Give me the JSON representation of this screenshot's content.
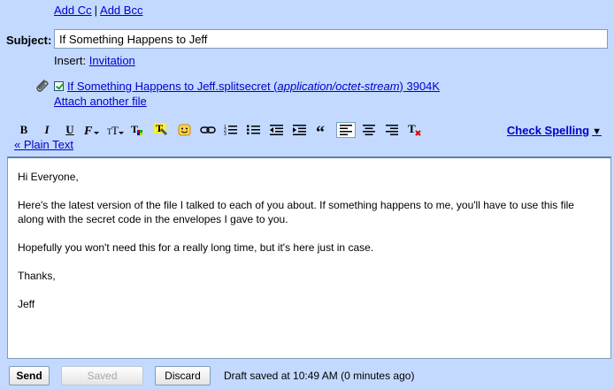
{
  "header": {
    "add_cc": "Add Cc",
    "cc_separator": "|",
    "add_bcc": "Add Bcc"
  },
  "subject": {
    "label": "Subject:",
    "value": "If Something Happens to Jeff"
  },
  "insert": {
    "label": "Insert:",
    "invitation": "Invitation"
  },
  "attachment": {
    "checked": true,
    "file_name": "If Something Happens to Jeff.splitsecret",
    "mime_type": "application/octet-stream",
    "size": "3904K",
    "attach_another": "Attach another file"
  },
  "toolbar": {
    "icons": [
      "bold-icon",
      "italic-icon",
      "underline-icon",
      "font-icon",
      "font-size-icon",
      "text-color-icon",
      "highlight-icon",
      "emoticon-icon",
      "link-icon",
      "numbered-list-icon",
      "bulleted-list-icon",
      "indent-less-icon",
      "indent-more-icon",
      "quote-icon",
      "align-left-icon",
      "align-center-icon",
      "align-right-icon",
      "remove-formatting-icon"
    ],
    "active": "align-left-icon",
    "check_spelling": "Check Spelling",
    "plain_text": "« Plain Text"
  },
  "body": {
    "paragraphs": [
      "Hi Everyone,",
      "Here's the latest version of the file I talked to each of you about. If something happens to me, you'll have to use this file along with the secret code in the envelopes I gave to you.",
      "Hopefully you won't need this for a really long time, but it's here just in case.",
      "Thanks,",
      "Jeff"
    ]
  },
  "footer": {
    "send": "Send",
    "saved": "Saved",
    "discard": "Discard",
    "draft_status": "Draft saved at 10:49 AM (0 minutes ago)"
  },
  "colors": {
    "background": "#c3d9ff",
    "link": "#0000cc"
  }
}
